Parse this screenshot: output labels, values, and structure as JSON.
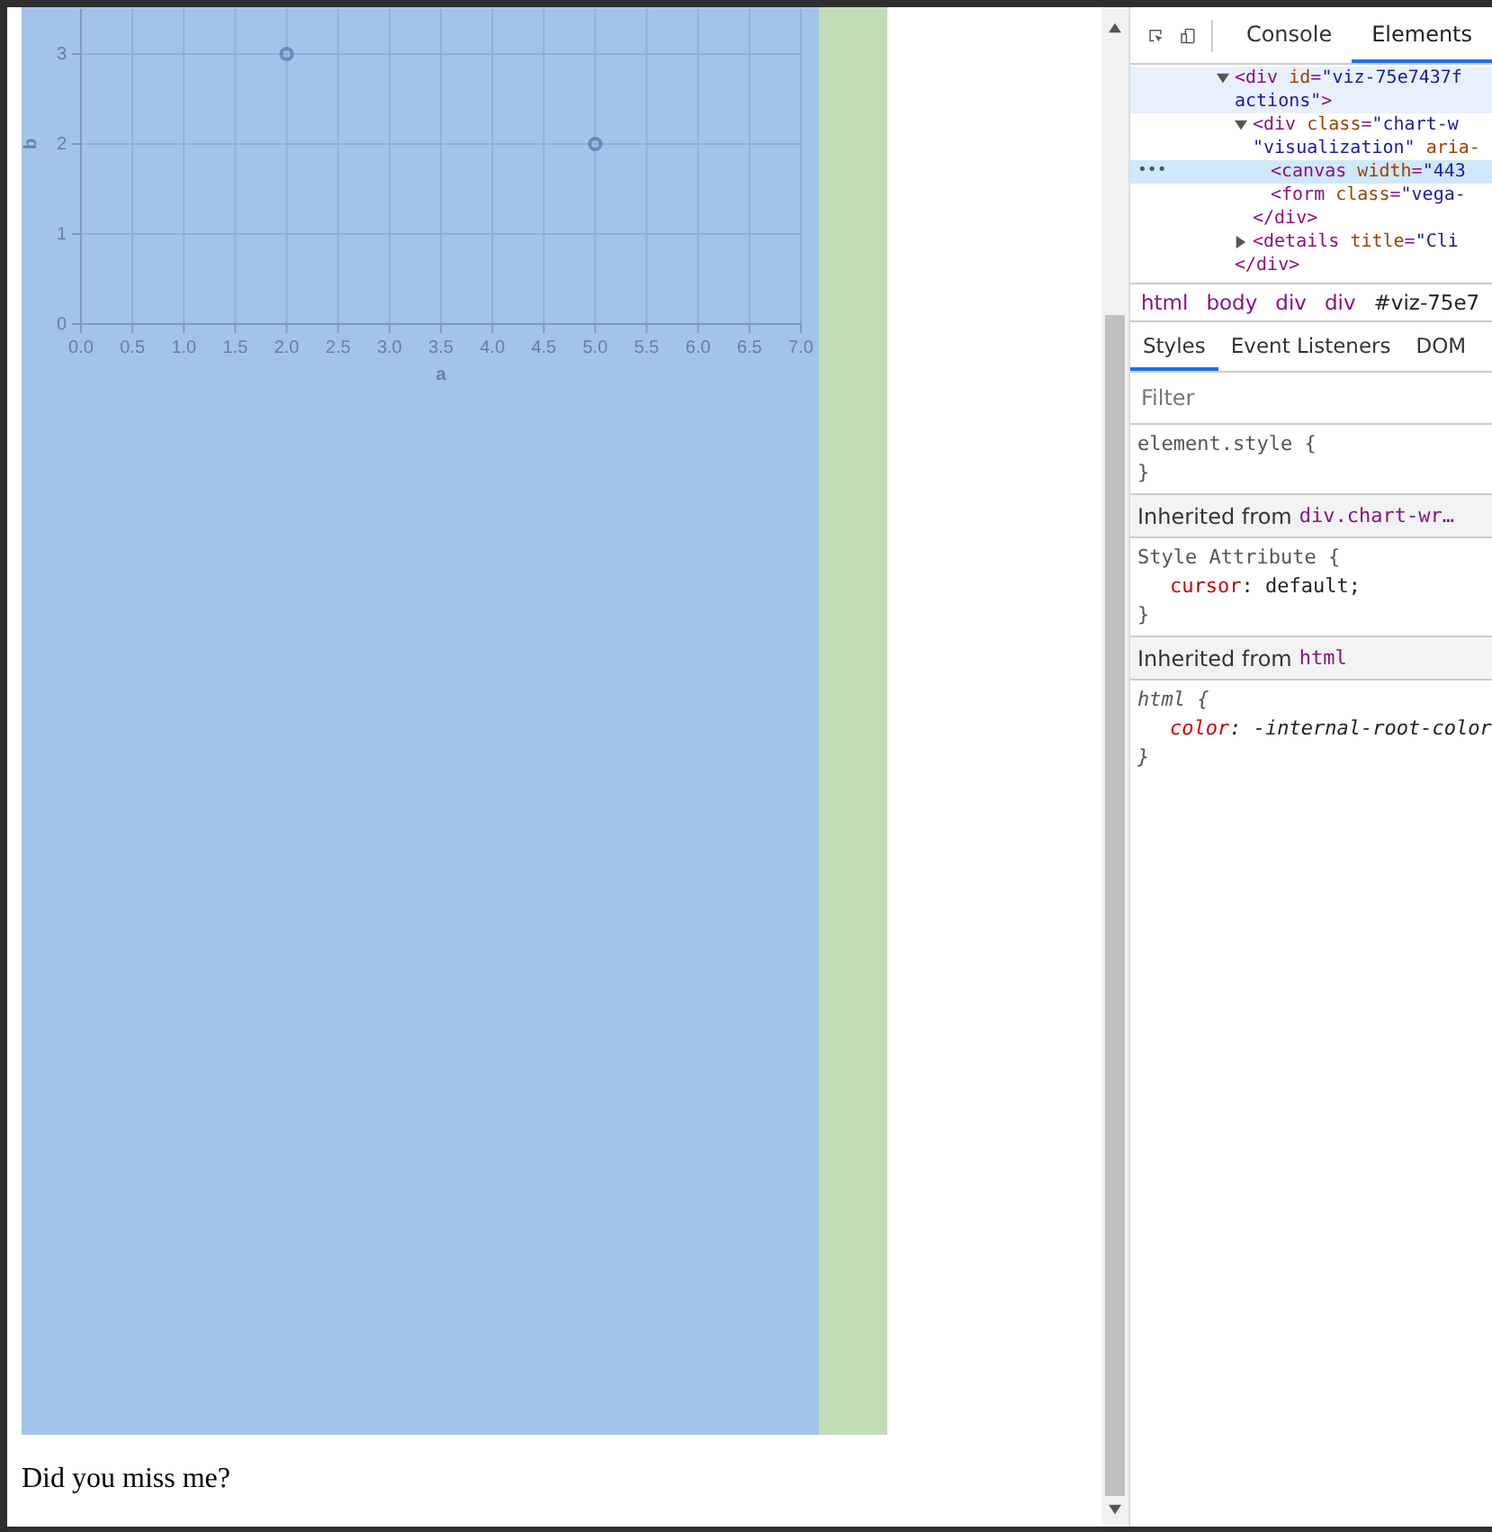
{
  "page": {
    "paragraph": "Did you miss me?",
    "chart_data": {
      "type": "scatter",
      "xlabel": "a",
      "ylabel": "b",
      "series": [
        {
          "color": "#4c78a8",
          "values": [
            3,
            2
          ]
        }
      ],
      "x": [
        2,
        5
      ],
      "xlim": [
        0,
        7
      ],
      "ylim": [
        0,
        3.5
      ],
      "grid": true,
      "xticks": [
        {
          "value": 0,
          "label": "0.0"
        },
        {
          "value": 0.5,
          "label": "0.5"
        },
        {
          "value": 1,
          "label": "1.0"
        },
        {
          "value": 1.5,
          "label": "1.5"
        },
        {
          "value": 2,
          "label": "2.0"
        },
        {
          "value": 2.5,
          "label": "2.5"
        },
        {
          "value": 3,
          "label": "3.0"
        },
        {
          "value": 3.5,
          "label": "3.5"
        },
        {
          "value": 4,
          "label": "4.0"
        },
        {
          "value": 4.5,
          "label": "4.5"
        },
        {
          "value": 5,
          "label": "5.0"
        },
        {
          "value": 5.5,
          "label": "5.5"
        },
        {
          "value": 6,
          "label": "6.0"
        },
        {
          "value": 6.5,
          "label": "6.5"
        },
        {
          "value": 7,
          "label": "7.0"
        }
      ],
      "yticks": [
        0,
        1,
        2,
        3
      ]
    }
  },
  "devtools": {
    "tabs": [
      {
        "label": "Console",
        "selected": false
      },
      {
        "label": "Elements",
        "selected": true
      }
    ],
    "tree": [
      {
        "expanded": true,
        "highlighted": true,
        "selected": false,
        "lines": [
          [
            {
              "kind": "tag",
              "t": "<div "
            },
            {
              "kind": "attr",
              "t": "id"
            },
            {
              "kind": "tag",
              "t": "="
            },
            {
              "kind": "value",
              "t": "\"viz-75e7437f"
            }
          ],
          [
            {
              "kind": "value",
              "t": "actions\""
            },
            {
              "kind": "tag",
              "t": ">"
            }
          ]
        ],
        "children": [
          {
            "expanded": true,
            "highlighted": false,
            "selected": false,
            "lines": [
              [
                {
                  "kind": "tag",
                  "t": "<div "
                },
                {
                  "kind": "attr",
                  "t": "class"
                },
                {
                  "kind": "tag",
                  "t": "="
                },
                {
                  "kind": "value",
                  "t": "\"chart-w"
                }
              ],
              [
                {
                  "kind": "value",
                  "t": "\"visualization\""
                },
                {
                  "kind": "attr",
                  "t": "aria-",
                  "spaced": true
                }
              ]
            ],
            "children": [
              {
                "highlighted": false,
                "selected": true,
                "lines": [
                  [
                    {
                      "kind": "tag",
                      "t": "<canvas "
                    },
                    {
                      "kind": "attr",
                      "t": "width"
                    },
                    {
                      "kind": "tag",
                      "t": "="
                    },
                    {
                      "kind": "value",
                      "t": "\"443"
                    }
                  ]
                ]
              },
              {
                "highlighted": false,
                "selected": false,
                "lines": [
                  [
                    {
                      "kind": "tag",
                      "t": "<form "
                    },
                    {
                      "kind": "attr",
                      "t": "class"
                    },
                    {
                      "kind": "tag",
                      "t": "="
                    },
                    {
                      "kind": "value",
                      "t": "\"vega-"
                    }
                  ]
                ]
              }
            ]
          },
          {
            "highlighted": false,
            "selected": false,
            "lines": [
              [
                {
                  "kind": "tag",
                  "t": "</div>"
                }
              ]
            ]
          },
          {
            "expanded": false,
            "highlighted": false,
            "selected": false,
            "lines": [
              [
                {
                  "kind": "tag",
                  "t": "<details "
                },
                {
                  "kind": "attr",
                  "t": "title"
                },
                {
                  "kind": "tag",
                  "t": "="
                },
                {
                  "kind": "value",
                  "t": "\"Cli"
                }
              ]
            ]
          }
        ]
      },
      {
        "highlighted": false,
        "selected": false,
        "lines": [
          [
            {
              "kind": "tag",
              "t": "</div>"
            }
          ]
        ]
      }
    ],
    "selected_marker": "•••",
    "breadcrumbs": [
      "html",
      "body",
      "div",
      "div",
      "#viz-75e7"
    ],
    "style_tabs": [
      {
        "label": "Styles",
        "selected": true
      },
      {
        "label": "Event Listeners",
        "selected": false
      },
      {
        "label": "DOM",
        "selected": false
      }
    ],
    "filter": {
      "placeholder": "Filter"
    },
    "sections": [
      {
        "kind": "rule",
        "selector": "element.style {",
        "italic": false,
        "close": "}"
      },
      {
        "kind": "inherited",
        "label": "Inherited from",
        "selector": "div.chart-wr…"
      },
      {
        "kind": "rule",
        "selector": "Style Attribute {",
        "italic": false,
        "props": [
          {
            "name": "cursor",
            "rest": ": default;"
          }
        ],
        "close": "}"
      },
      {
        "kind": "inherited",
        "label": "Inherited from",
        "selector": "html"
      },
      {
        "kind": "rule",
        "selector": "html {",
        "italic": true,
        "props": [
          {
            "name": "color",
            "rest": ": -internal-root-color"
          }
        ],
        "close": "}"
      }
    ]
  }
}
